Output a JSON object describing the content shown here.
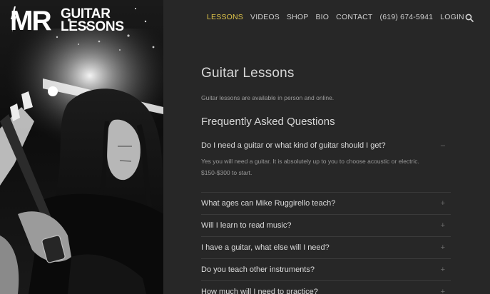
{
  "logo": {
    "mr": "MR",
    "guitar": "GUITAR",
    "lessons": "LESSONS"
  },
  "nav": {
    "items": [
      {
        "label": "LESSONS",
        "active": true
      },
      {
        "label": "VIDEOS",
        "active": false
      },
      {
        "label": "SHOP",
        "active": false
      },
      {
        "label": "BIO",
        "active": false
      },
      {
        "label": "CONTACT",
        "active": false
      },
      {
        "label": "(619) 674-5941",
        "active": false
      },
      {
        "label": "LOGIN",
        "active": false
      }
    ],
    "search_icon": "search-icon",
    "active_color": "#e0c54a"
  },
  "main": {
    "title": "Guitar Lessons",
    "intro": "Guitar lessons are available in person and online.",
    "faq_title": "Frequently Asked Questions",
    "faq": [
      {
        "q": "Do I need a guitar or what kind of guitar should I get?",
        "toggle": "–",
        "open": true,
        "a1": "Yes you will need a guitar. It is absolutely up to you to choose acoustic or electric.",
        "a2": "$150-$300 to start."
      },
      {
        "q": "What ages can Mike Ruggirello teach?",
        "toggle": "+",
        "open": false
      },
      {
        "q": "Will I learn to read music?",
        "toggle": "+",
        "open": false
      },
      {
        "q": "I have a guitar, what else will I need?",
        "toggle": "+",
        "open": false
      },
      {
        "q": "Do you teach other instruments?",
        "toggle": "+",
        "open": false
      },
      {
        "q": "How much will I need to practice?",
        "toggle": "+",
        "open": false
      }
    ]
  },
  "colors": {
    "background": "#272727",
    "text": "#cfcfcf"
  }
}
